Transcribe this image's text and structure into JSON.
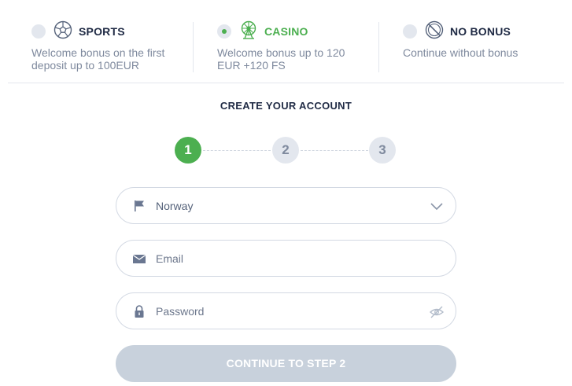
{
  "bonuses": [
    {
      "title": "SPORTS",
      "description": "Welcome bonus on the first deposit up to 100EUR",
      "icon": "soccer-ball-icon",
      "selected": false
    },
    {
      "title": "CASINO",
      "description": "Welcome bonus up to 120 EUR +120 FS",
      "icon": "ferris-wheel-icon",
      "selected": true
    },
    {
      "title": "NO BONUS",
      "description": "Continue without bonus",
      "icon": "no-bonus-icon",
      "selected": false
    }
  ],
  "form": {
    "title": "CREATE YOUR ACCOUNT",
    "steps": [
      "1",
      "2",
      "3"
    ],
    "active_step": 1,
    "country": {
      "value": "Norway",
      "icon": "flag-icon"
    },
    "email": {
      "placeholder": "Email",
      "icon": "envelope-icon"
    },
    "password": {
      "placeholder": "Password",
      "icon": "lock-icon",
      "toggle_icon": "eye-hidden-icon"
    },
    "continue_label": "CONTINUE TO STEP 2"
  },
  "colors": {
    "accent": "#4caf50",
    "inactive": "#e3e7ee",
    "button_disabled": "#c8d1dc",
    "text_dark": "#1f2a44",
    "text_muted": "#7f8a9e"
  }
}
